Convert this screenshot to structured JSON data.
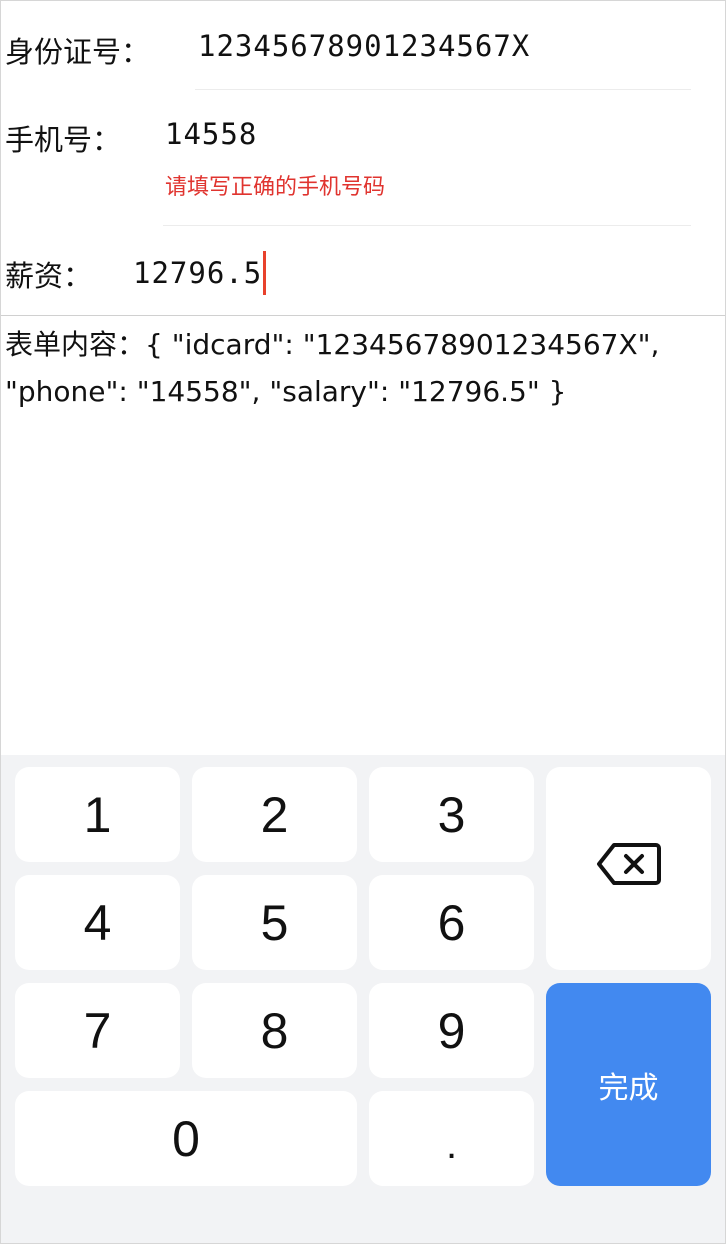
{
  "form": {
    "idcard": {
      "label": "身份证号：",
      "value": "12345678901234567X"
    },
    "phone": {
      "label": "手机号：",
      "value": "14558",
      "error": "请填写正确的手机号码"
    },
    "salary": {
      "label": "薪资：",
      "value": "12796.5"
    }
  },
  "output": {
    "label": "表单内容：",
    "text": "{ \"idcard\": \"12345678901234567X\", \"phone\": \"14558\", \"salary\": \"12796.5\" }"
  },
  "keyboard": {
    "keys": [
      "1",
      "2",
      "3",
      "4",
      "5",
      "6",
      "7",
      "8",
      "9",
      "0",
      "."
    ],
    "delete_icon": "backspace-icon",
    "done_label": "完成"
  },
  "colors": {
    "error": "#e0342f",
    "caret": "#e8412c",
    "done_button": "#4289f0",
    "keyboard_bg": "#f2f3f5"
  }
}
